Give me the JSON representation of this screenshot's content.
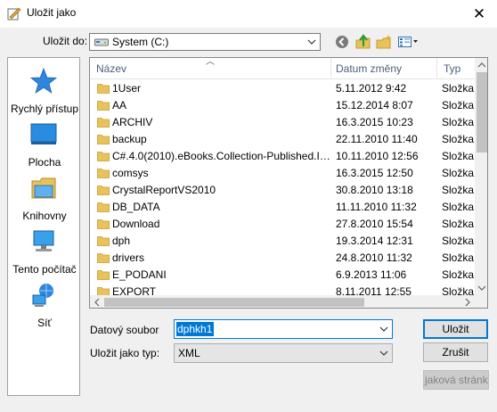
{
  "window": {
    "title": "Uložit jako",
    "close_glyph": "✕"
  },
  "toolbar": {
    "save_in_label": "Uložit do:",
    "location": "System (C:)",
    "icons": [
      "back-icon",
      "up-folder-icon",
      "new-folder-icon",
      "views-menu-icon"
    ]
  },
  "places": [
    {
      "label": "Rychlý přístup",
      "icon": "quick-access-star-icon"
    },
    {
      "label": "Plocha",
      "icon": "desktop-icon"
    },
    {
      "label": "Knihovny",
      "icon": "libraries-icon"
    },
    {
      "label": "Tento počítač",
      "icon": "this-pc-icon"
    },
    {
      "label": "Síť",
      "icon": "network-icon"
    }
  ],
  "file_list": {
    "columns": {
      "name": "Název",
      "date": "Datum změny",
      "type": "Typ"
    },
    "rows": [
      {
        "name": "1User",
        "date": "5.11.2012 9:42",
        "type": "Složka"
      },
      {
        "name": "AA",
        "date": "15.12.2014 8:07",
        "type": "Složka"
      },
      {
        "name": "ARCHIV",
        "date": "16.3.2015 10:23",
        "type": "Složka"
      },
      {
        "name": "backup",
        "date": "22.11.2010 11:40",
        "type": "Složka"
      },
      {
        "name": "C#.4.0(2010).eBooks.Collection-Published.In...",
        "date": "10.11.2010 12:56",
        "type": "Složka"
      },
      {
        "name": "comsys",
        "date": "16.3.2015 12:50",
        "type": "Složka"
      },
      {
        "name": "CrystalReportVS2010",
        "date": "30.8.2010 13:18",
        "type": "Složka"
      },
      {
        "name": "DB_DATA",
        "date": "11.11.2010 11:32",
        "type": "Složka"
      },
      {
        "name": "Download",
        "date": "27.8.2010 15:54",
        "type": "Složka"
      },
      {
        "name": "dph",
        "date": "19.3.2014 12:31",
        "type": "Složka"
      },
      {
        "name": "drivers",
        "date": "24.8.2010 11:32",
        "type": "Složka"
      },
      {
        "name": "E_PODANI",
        "date": "6.9.2013 11:06",
        "type": "Složka"
      },
      {
        "name": "EXPORT",
        "date": "8.11.2011 12:55",
        "type": "Složka"
      }
    ]
  },
  "form": {
    "filename_label": "Datový soubor",
    "filename_value": "dphkh1",
    "type_label": "Uložit jako typ:",
    "type_value": "XML"
  },
  "buttons": {
    "save": "Uložit",
    "cancel": "Zrušit",
    "help": "jaková stránka"
  },
  "colors": {
    "accent": "#0078d7",
    "folder": "#e8c35c",
    "dialog_bg": "#f0f0f0"
  }
}
